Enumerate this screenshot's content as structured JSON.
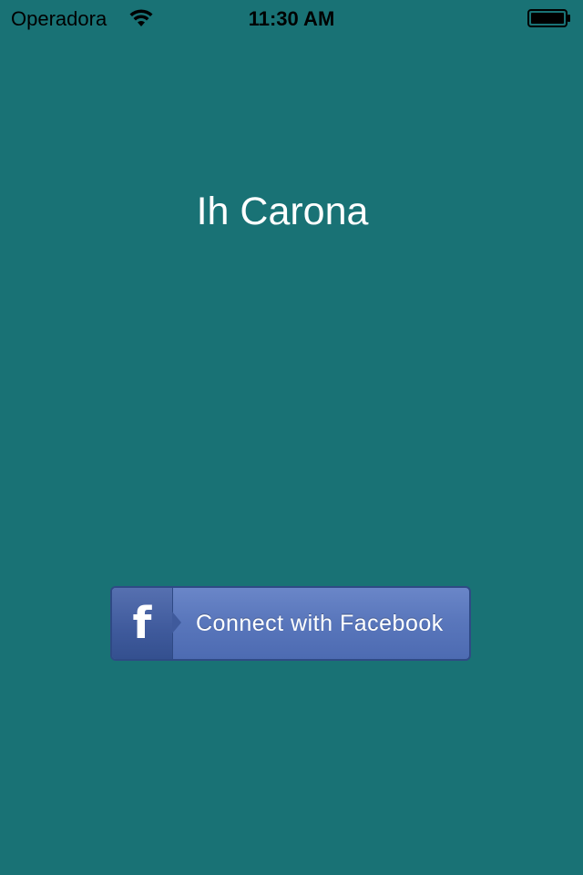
{
  "status_bar": {
    "carrier": "Operadora",
    "time": "11:30 AM",
    "wifi_icon": "wifi-icon",
    "battery_icon": "battery-icon"
  },
  "app": {
    "title": "Ih Carona"
  },
  "facebook_button": {
    "logo_glyph": "f",
    "label": "Connect with Facebook",
    "icon": "facebook-logo-icon"
  },
  "colors": {
    "background": "#197275",
    "facebook_blue": "#5a77bc",
    "text": "#ffffff"
  }
}
